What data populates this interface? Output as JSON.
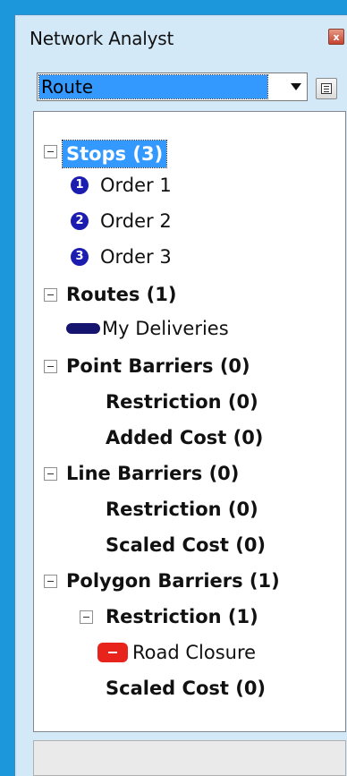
{
  "window": {
    "title": "Network Analyst",
    "close_glyph": "x"
  },
  "analysis_combo": {
    "value": "Route"
  },
  "tree": {
    "stops": {
      "label": "Stops (3)",
      "items": [
        {
          "num": "1",
          "label": "Order 1"
        },
        {
          "num": "2",
          "label": "Order 2"
        },
        {
          "num": "3",
          "label": "Order 3"
        }
      ]
    },
    "routes": {
      "label": "Routes (1)",
      "items": [
        {
          "label": "My Deliveries"
        }
      ]
    },
    "point_barriers": {
      "label": "Point Barriers (0)",
      "restriction": "Restriction (0)",
      "added_cost": "Added Cost (0)"
    },
    "line_barriers": {
      "label": "Line Barriers (0)",
      "restriction": "Restriction (0)",
      "scaled_cost": "Scaled Cost (0)"
    },
    "polygon_barriers": {
      "label": "Polygon Barriers (1)",
      "restriction": "Restriction (1)",
      "road_closure": "Road Closure",
      "scaled_cost": "Scaled Cost (0)"
    }
  },
  "colors": {
    "selection": "#3399ff",
    "stop_icon": "#1c1cb0",
    "route_icon": "#151570",
    "barrier_icon": "#e8231c",
    "desktop": "#1c97dc"
  },
  "icons": [
    "close-icon",
    "dropdown-arrow-icon",
    "list-view-icon",
    "collapse-icon",
    "stop-number-icon",
    "route-line-icon",
    "polygon-barrier-icon"
  ]
}
